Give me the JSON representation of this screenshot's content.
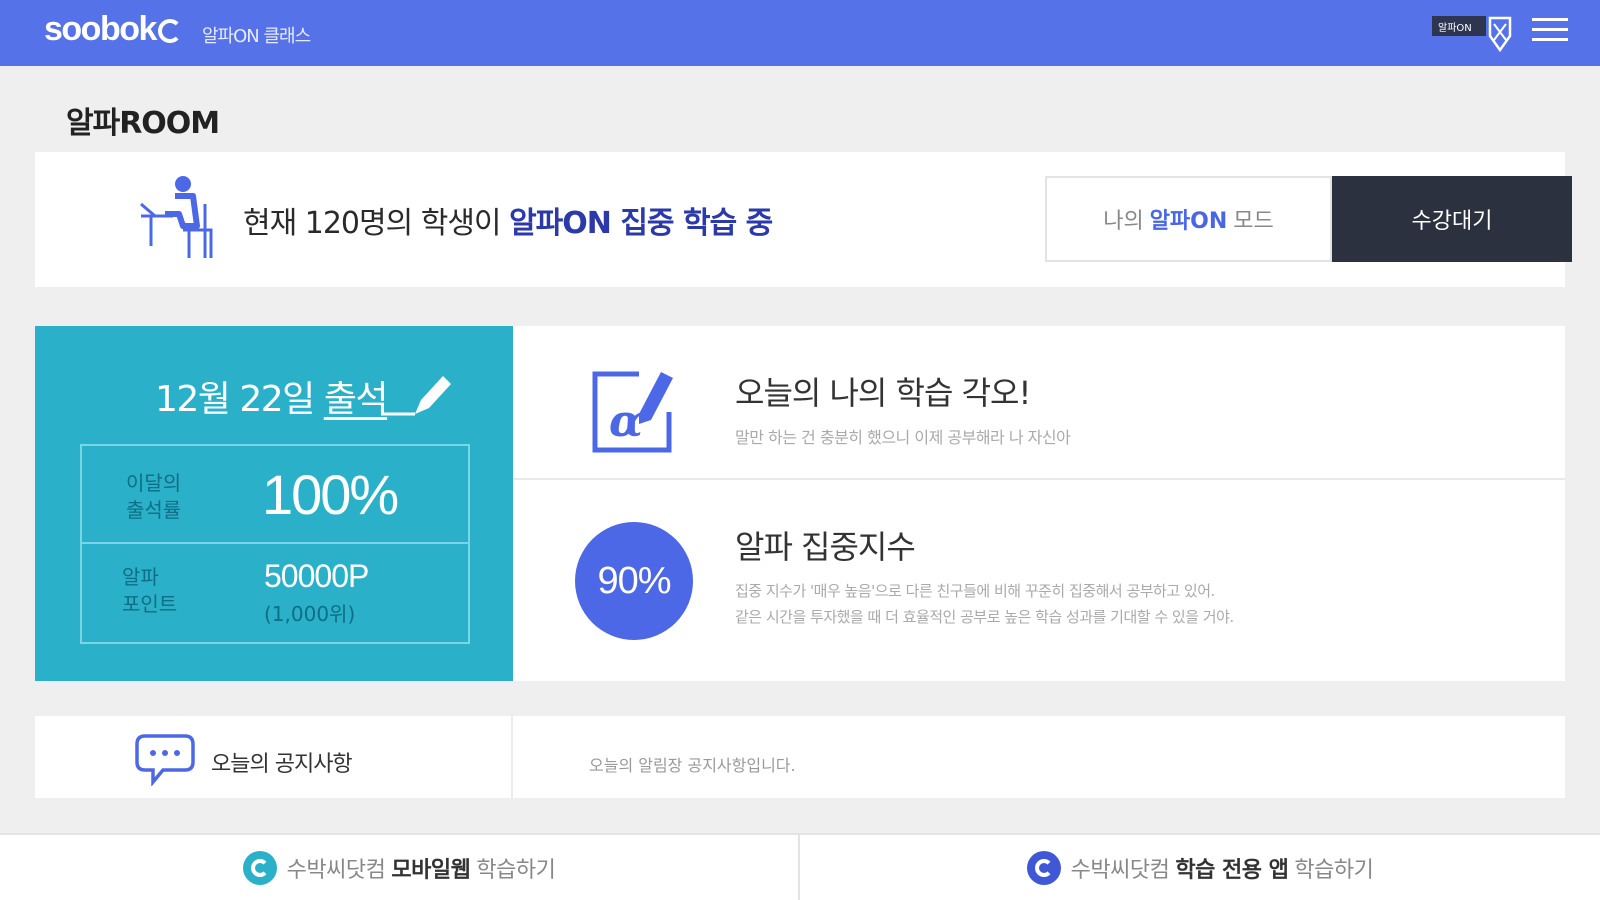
{
  "header": {
    "logo_text": "soobok",
    "subtitle": "알파ON 클래스",
    "badge_text": "알파ON",
    "menu_icon": "hamburger-icon",
    "color": "#5572e8"
  },
  "page": {
    "title": "알파ROOM"
  },
  "live": {
    "prefix": "현재 120명의 학생이 ",
    "highlight": "알파ON 집중 학습 중",
    "mode_prefix": "나의",
    "mode_highlight": "알파ON",
    "mode_suffix": "모드",
    "wait_button": "수강대기"
  },
  "attendance": {
    "date": "12월 22일",
    "check_label": "출석",
    "rate_label_1": "이달의",
    "rate_label_2": "출석률",
    "rate_value": "100%",
    "points_label_1": "알파",
    "points_label_2": "포인트",
    "points_value": "50000P",
    "points_sub": "(1,000위)",
    "color": "#2ab1c9"
  },
  "resolve": {
    "title": "오늘의 나의 학습 각오!",
    "desc": "말만 하는 건 충분히 했으니 이제 공부해라 나 자신아"
  },
  "focus": {
    "percent": "90%",
    "title": "알파 집중지수",
    "desc_line1": "집중 지수가 '매우 높음'으로 다른 친구들에 비해 꾸준히 집중해서 공부하고 있어.",
    "desc_line2": "같은 시간을 투자했을 때 더 효율적인 공부로 높은 학습 성과를 기대할 수 있을 거야."
  },
  "notice": {
    "label": "오늘의 공지사항",
    "text": "오늘의 알림장 공지사항입니다."
  },
  "bottom": {
    "left_prefix": "수박씨닷컴",
    "left_bold": "모바일웹",
    "left_suffix": "학습하기",
    "right_prefix": "수박씨닷컴",
    "right_bold": "학습 전용 앱",
    "right_suffix": "학습하기"
  }
}
